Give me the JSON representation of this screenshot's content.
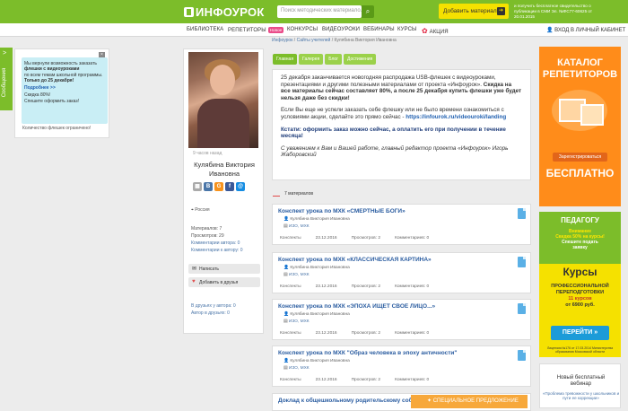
{
  "header": {
    "logo": "ИНФОУРОК",
    "search_placeholder": "Поиск методических материало...",
    "add_material": "Добавить материал",
    "cert_text": "и получить бесплатное свидетельство о публикации в СМИ Эл. №ФС77-60625 от 20.01.2015"
  },
  "nav": {
    "items": [
      "БИБЛИОТЕКА",
      "РЕПЕТИТОРЫ",
      "КОНКУРСЫ",
      "ВИДЕОУРОКИ",
      "ВЕБИНАРЫ",
      "КУРСЫ",
      "АКЦИЯ"
    ],
    "new_badge": "Новое",
    "cabinet": "ВХОД В ЛИЧНЫЙ КАБИНЕТ"
  },
  "sidetab": {
    "label": "Сообщения",
    "arrow": ">"
  },
  "promo": {
    "close": "×",
    "line1": "Мы вернули возможность заказать",
    "line2": "флешки с видеоуроками",
    "line3": "по всем темам школьной программы.",
    "line4": "Только до 25 декабря!",
    "more": "Подробнее >>",
    "line5": "Скидка 80%!",
    "line6": "Спешите оформить заказ!",
    "footer": "Количество флешек ограничено!"
  },
  "profile": {
    "online": "9 часов назад",
    "name": "Кулябина Виктория Ивановна",
    "socials": [
      "В",
      "G",
      "f",
      "@"
    ],
    "city": "Россия",
    "materials": "Материалов: 7",
    "views": "Просмотров: 29",
    "comments_by": "Комментарии автора: 0",
    "comments_to": "Комментарии к автору: 0",
    "write_btn": "Написать",
    "add_friend_btn": "Добавить в друзья",
    "friends_in": "В друзьях у автора: 0",
    "friends_of": "Автор в друзьях: 0"
  },
  "breadcrumbs": {
    "home": "Инфоурок",
    "teachers": "Сайты учителей",
    "current": "Кулябина Виктория Ивановна"
  },
  "tabs": [
    "Главная",
    "Галерея",
    "Блог",
    "Достижения"
  ],
  "notice": {
    "p1_plain": "25 декабря заканчивается новогодняя распродажа USB-флешек с видеоуроками, презентациями и другими полезными материалами от проекта «Инфоурок».",
    "p1_bold": " Скидка на все материалы сейчас составляет 80%, а после 25 декабря купить флешки уже будет нельзя даже без скидки!",
    "p2_plain": "Если Вы еще не успели заказать себе флешку или не было времени ознакомиться с условиями акции, сделайте это прямо сейчас - ",
    "p2_link": "https://infourok.ru/videouroki/landing",
    "p3": "Кстати: оформить заказ можно сейчас, а оплатить его при получении в течение месяца!",
    "p4": "С уважением к Вам и Вашей работе, главный редактор проекта «Инфоурок» Игорь Жаборовский"
  },
  "materials_count": "7 материалов",
  "cards": [
    {
      "title": "Конспект урока по МХК «СМЕРТНЫЕ БОГИ»",
      "author": "Кулябина Виктория Ивановна",
      "subject": "ИЗО, МХК",
      "type": "Конспекты",
      "date": "23.12.2016",
      "views": "Просмотров: 2",
      "comments": "Комментариев: 0"
    },
    {
      "title": "Конспект урока по МХК «КЛАССИЧЕСКАЯ КАРТИНА»",
      "author": "Кулябина Виктория Ивановна",
      "subject": "ИЗО, МХК",
      "type": "Конспекты",
      "date": "23.12.2016",
      "views": "Просмотров: 2",
      "comments": "Комментариев: 0"
    },
    {
      "title": "Конспект урока по МХК «ЭПОХА ИЩЕТ СВОЁ ЛИЦО...»",
      "author": "Кулябина Виктория Ивановна",
      "subject": "ИЗО, МХК",
      "type": "Конспекты",
      "date": "23.12.2016",
      "views": "Просмотров: 2",
      "comments": "Комментариев: 0"
    },
    {
      "title": "Конспект урока по МХК \"Образ человека в эпоху античности\"",
      "author": "Кулябина Виктория Ивановна",
      "subject": "ИЗО, МХК",
      "type": "Конспекты",
      "date": "23.12.2016",
      "views": "Просмотров: 2",
      "comments": "Комментариев: 0"
    },
    {
      "title": "Доклад к общешкольному родительскому собранию",
      "author": "",
      "subject": "",
      "type": "",
      "date": "",
      "views": "",
      "comments": ""
    }
  ],
  "special_offer": "СПЕЦИАЛЬНОЕ ПРЕДЛОЖЕНИЕ",
  "right_ad1": {
    "title1": "КАТАЛОГ",
    "title2": "РЕПЕТИТОРОВ",
    "register": "Зарегистрироваться",
    "big": "БЕСПЛАТНО"
  },
  "right_ad2": {
    "title": "ПЕДАГОГУ",
    "discount1": "Внимание",
    "discount2": "Скидка 50% на курсы!",
    "hurry1": "Спешите подать",
    "hurry2": "заявку",
    "courses": "Курсы",
    "prof": "ПРОФЕССИОНАЛЬНОЙ ПЕРЕПОДГОТОВКИ",
    "count": "11 курсов",
    "price": "от 6900 руб.",
    "go": "ПЕРЕЙТИ »",
    "license": "Лицензия №176 от 17.03.2014 Министерства образования Московской области"
  },
  "right_ad3": {
    "title1": "Новый бесплатный",
    "title2": "вебинар",
    "sub": "«Проблема тревожности у школьников и пути ее коррекции»"
  }
}
